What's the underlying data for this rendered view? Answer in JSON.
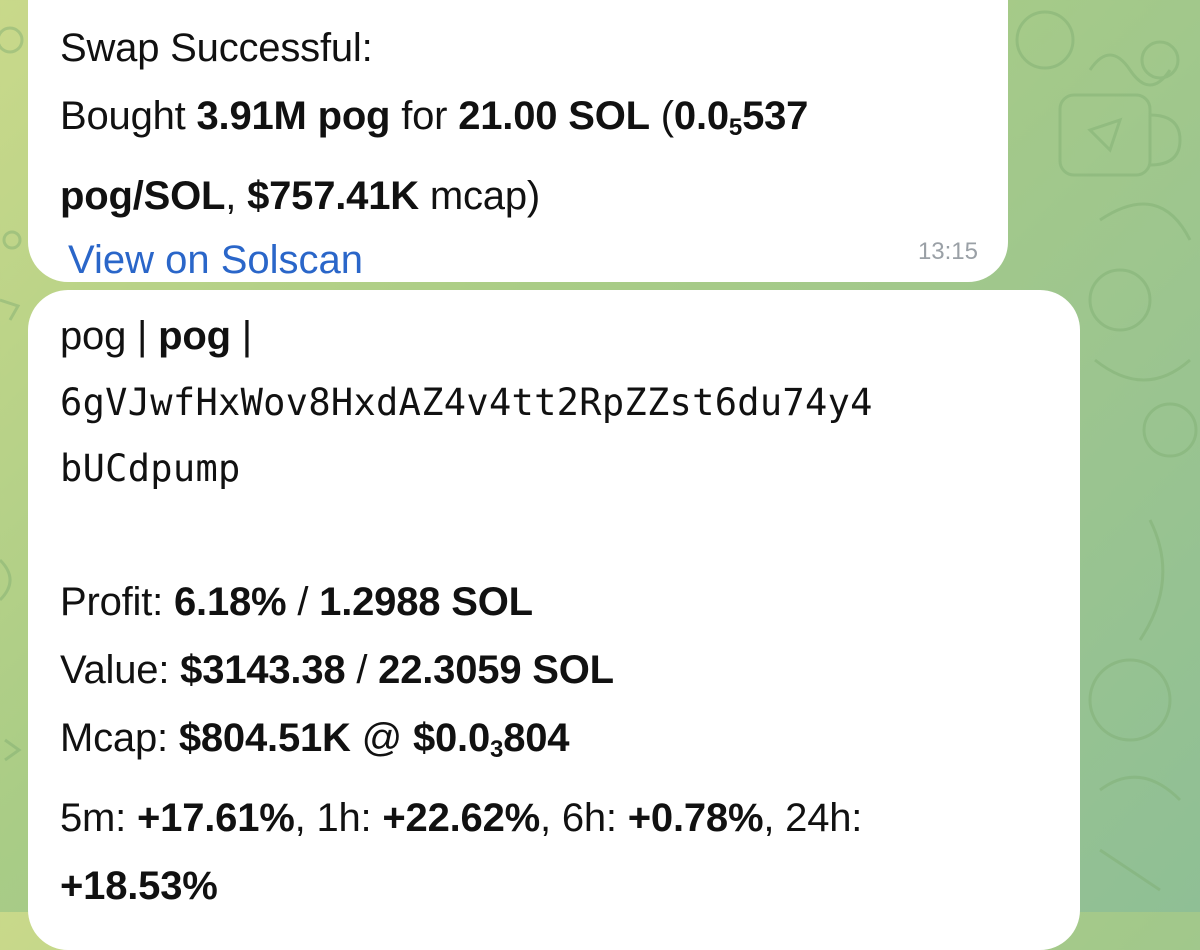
{
  "swap_message": {
    "title": "Swap Successful:",
    "bought_prefix": "Bought ",
    "amount": "3.91M pog",
    "for_text": " for ",
    "sol_amount": "21.00 SOL",
    "open_paren": " (",
    "price_main": "0.0",
    "price_sub": "5",
    "price_tail": "537",
    "price_unit": "pog/SOL",
    "comma": ", ",
    "mcap_value": "$757.41K",
    "mcap_suffix": " mcap)",
    "link_text": "View on Solscan",
    "timestamp": "13:15"
  },
  "token_message": {
    "name_plain": "pog | ",
    "symbol": "pog",
    "sep": " |",
    "address_line1": "6gVJwfHxWov8HxdAZ4v4tt2RpZZst6du74y4",
    "address_line2": "bUCdpump",
    "profit_label": "Profit: ",
    "profit_pct": "6.18%",
    "slash": " / ",
    "profit_sol": "1.2988 SOL",
    "value_label": "Value: ",
    "value_usd": "$3143.38",
    "value_sol": "22.3059 SOL",
    "mcap_label": "Mcap: ",
    "mcap_value": "$804.51K",
    "at": " @ ",
    "price_main": "$0.0",
    "price_sub": "3",
    "price_tail": "804",
    "m5_label": "5m: ",
    "m5_value": "+17.61%",
    "h1_label": ", 1h: ",
    "h1_value": "+22.62%",
    "h6_label": ", 6h: ",
    "h6_value": "+0.78%",
    "h24_label": ", 24h:",
    "h24_value": "+18.53%"
  }
}
